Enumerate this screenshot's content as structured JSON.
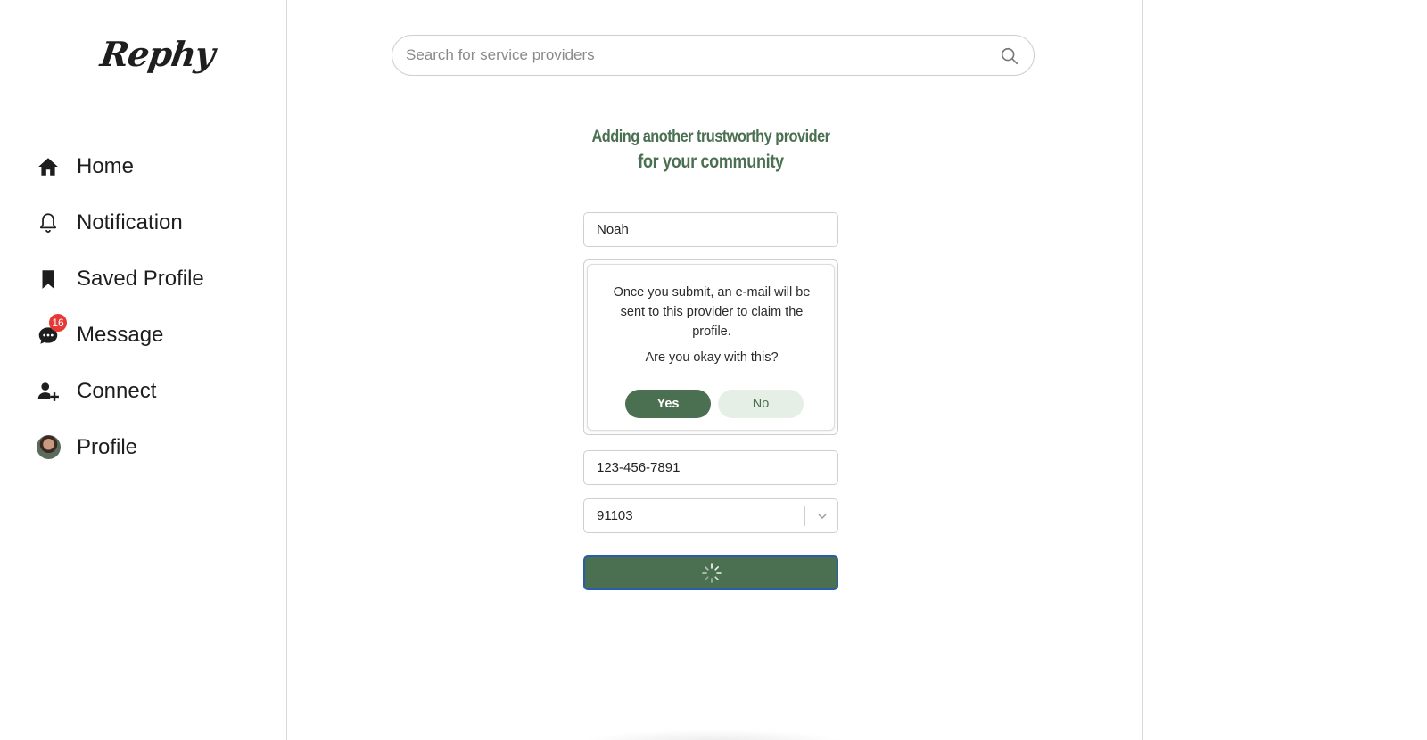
{
  "app": {
    "logo_text": "Rephy"
  },
  "sidebar": {
    "items": [
      {
        "label": "Home",
        "icon": "home-icon"
      },
      {
        "label": "Notification",
        "icon": "bell-icon"
      },
      {
        "label": "Saved Profile",
        "icon": "bookmark-icon"
      },
      {
        "label": "Message",
        "icon": "chat-icon",
        "badge": "16"
      },
      {
        "label": "Connect",
        "icon": "add-user-icon"
      },
      {
        "label": "Profile",
        "icon": "avatar"
      }
    ]
  },
  "search": {
    "placeholder": "Search for service providers",
    "value": ""
  },
  "form": {
    "headline_line1": "Adding another trustworthy provider",
    "headline_line2": "for your community",
    "name_value": "Noah",
    "phone_value": "123-456-7891",
    "zip_value": "91103",
    "submit_state": "loading"
  },
  "confirm": {
    "message": "Once you submit, an e-mail will be sent to this provider to claim the profile.",
    "question": "Are you okay with this?",
    "yes_label": "Yes",
    "no_label": "No"
  },
  "colors": {
    "accent": "#4b7051",
    "accent_light": "#e6efe6",
    "badge": "#e53935",
    "focus_ring": "#2a5da8"
  }
}
